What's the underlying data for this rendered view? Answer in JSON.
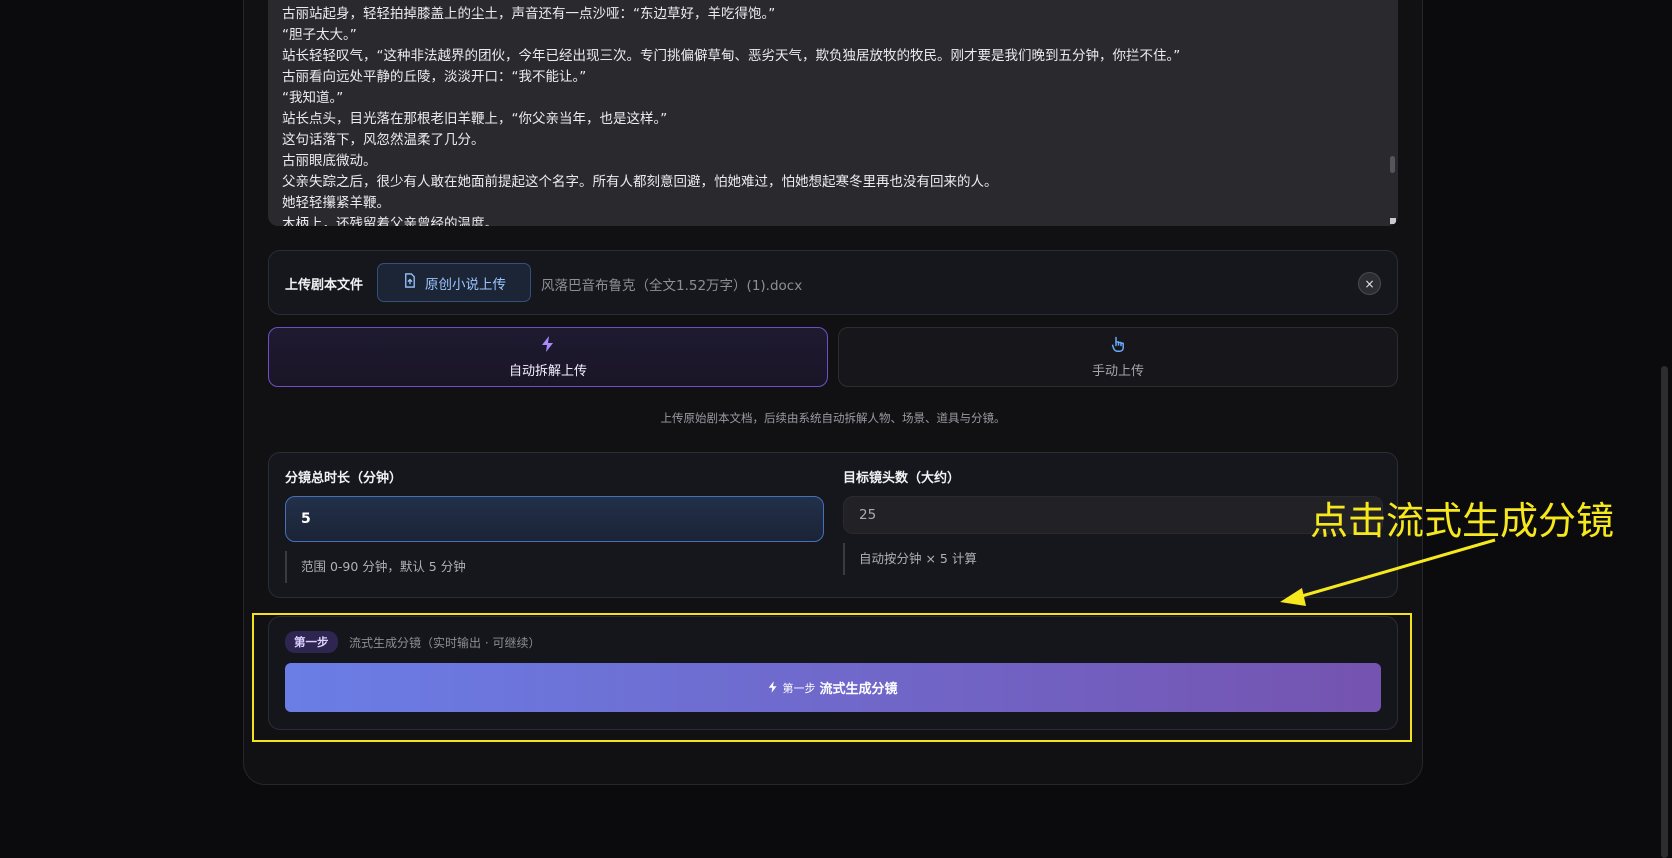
{
  "story": {
    "lines": [
      "古丽站起身，轻轻拍掉膝盖上的尘土，声音还有一点沙哑：“东边草好，羊吃得饱。”",
      "“胆子太大。”",
      "站长轻轻叹气，“这种非法越界的团伙，今年已经出现三次。专门挑偏僻草甸、恶劣天气，欺负独居放牧的牧民。刚才要是我们晚到五分钟，你拦不住。”",
      "古丽看向远处平静的丘陵，淡淡开口：“我不能让。”",
      "“我知道。”",
      "站长点头，目光落在那根老旧羊鞭上，“你父亲当年，也是这样。”",
      "这句话落下，风忽然温柔了几分。",
      "古丽眼底微动。",
      "父亲失踪之后，很少有人敢在她面前提起这个名字。所有人都刻意回避，怕她难过，怕她想起寒冬里再也没有回来的人。",
      "她轻轻攥紧羊鞭。",
      "木柄上，还残留着父亲曾经的温度。"
    ]
  },
  "upload": {
    "label": "上传剧本文件",
    "button_label": "原创小说上传",
    "file_name": "风落巴音布鲁克（全文1.52万字）(1).docx",
    "close_symbol": "×"
  },
  "modes": {
    "auto_label": "自动拆解上传",
    "manual_label": "手动上传",
    "auto_icon": "lightning-icon",
    "manual_icon": "hand-pointer-icon"
  },
  "hint": "上传原始剧本文档，后续由系统自动拆解人物、场景、道具与分镜。",
  "settings": {
    "duration_label": "分镜总时长（分钟）",
    "duration_value": "5",
    "duration_note": "范围 0-90 分钟，默认 5 分钟",
    "shots_label": "目标镜头数（大约）",
    "shots_value": "25",
    "shots_note": "自动按分钟 × 5 计算"
  },
  "step": {
    "badge": "第一步",
    "description": "流式生成分镜（实时输出 · 可继续）",
    "button_prefix": "第一步",
    "button_label": "流式生成分镜"
  },
  "annotation": {
    "text": "点击流式生成分镜",
    "color": "#f7e81e"
  },
  "colors": {
    "accent_purple": "#6f4fc4",
    "accent_blue": "#4670b8",
    "button_gradient_start": "#6a7ee6",
    "button_gradient_end": "#7553b0"
  }
}
